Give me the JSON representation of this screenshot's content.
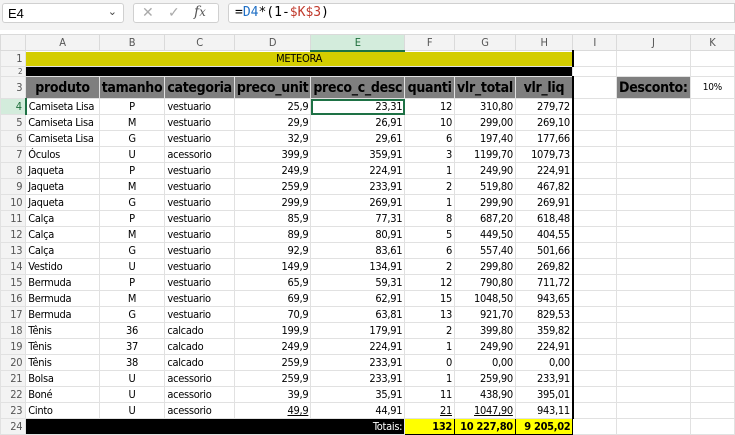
{
  "name_box": "E4",
  "formula": {
    "eq": "=",
    "ref1": "D4",
    "mid": "*(1-",
    "ref2": "$K$3",
    "end": ")"
  },
  "columns": [
    "A",
    "B",
    "C",
    "D",
    "E",
    "F",
    "G",
    "H",
    "I",
    "J",
    "K"
  ],
  "title": "METEORA",
  "headers": [
    "produto",
    "tamanho",
    "categoria",
    "preco_unit",
    "preco_c_desc",
    "quanti",
    "vlr_total",
    "vlr_liq"
  ],
  "discount": {
    "label": "Desconto:",
    "value": "10%"
  },
  "rows": [
    [
      "Camiseta Lisa",
      "P",
      "vestuario",
      "25,9",
      "23,31",
      "12",
      "310,80",
      "279,72"
    ],
    [
      "Camiseta Lisa",
      "M",
      "vestuario",
      "29,9",
      "26,91",
      "10",
      "299,00",
      "269,10"
    ],
    [
      "Camiseta Lisa",
      "G",
      "vestuario",
      "32,9",
      "29,61",
      "6",
      "197,40",
      "177,66"
    ],
    [
      "Óculos",
      "U",
      "acessorio",
      "399,9",
      "359,91",
      "3",
      "1199,70",
      "1079,73"
    ],
    [
      "Jaqueta",
      "P",
      "vestuario",
      "249,9",
      "224,91",
      "1",
      "249,90",
      "224,91"
    ],
    [
      "Jaqueta",
      "M",
      "vestuario",
      "259,9",
      "233,91",
      "2",
      "519,80",
      "467,82"
    ],
    [
      "Jaqueta",
      "G",
      "vestuario",
      "299,9",
      "269,91",
      "1",
      "299,90",
      "269,91"
    ],
    [
      "Calça",
      "P",
      "vestuario",
      "85,9",
      "77,31",
      "8",
      "687,20",
      "618,48"
    ],
    [
      "Calça",
      "M",
      "vestuario",
      "89,9",
      "80,91",
      "5",
      "449,50",
      "404,55"
    ],
    [
      "Calça",
      "G",
      "vestuario",
      "92,9",
      "83,61",
      "6",
      "557,40",
      "501,66"
    ],
    [
      "Vestido",
      "U",
      "vestuario",
      "149,9",
      "134,91",
      "2",
      "299,80",
      "269,82"
    ],
    [
      "Bermuda",
      "P",
      "vestuario",
      "65,9",
      "59,31",
      "12",
      "790,80",
      "711,72"
    ],
    [
      "Bermuda",
      "M",
      "vestuario",
      "69,9",
      "62,91",
      "15",
      "1048,50",
      "943,65"
    ],
    [
      "Bermuda",
      "G",
      "vestuario",
      "70,9",
      "63,81",
      "13",
      "921,70",
      "829,53"
    ],
    [
      "Tênis",
      "36",
      "calcado",
      "199,9",
      "179,91",
      "2",
      "399,80",
      "359,82"
    ],
    [
      "Tênis",
      "37",
      "calcado",
      "249,9",
      "224,91",
      "1",
      "249,90",
      "224,91"
    ],
    [
      "Tênis",
      "38",
      "calcado",
      "259,9",
      "233,91",
      "0",
      "0,00",
      "0,00"
    ],
    [
      "Bolsa",
      "U",
      "acessorio",
      "259,9",
      "233,91",
      "1",
      "259,90",
      "233,91"
    ],
    [
      "Boné",
      "U",
      "acessorio",
      "39,9",
      "35,91",
      "11",
      "438,90",
      "395,01"
    ],
    [
      "Cinto",
      "U",
      "acessorio",
      "49,9",
      "44,91",
      "21",
      "1047,90",
      "943,11"
    ]
  ],
  "totals": {
    "label": "Totais:",
    "quantity": "132",
    "total": "10 227,80",
    "net": "9 205,02"
  }
}
